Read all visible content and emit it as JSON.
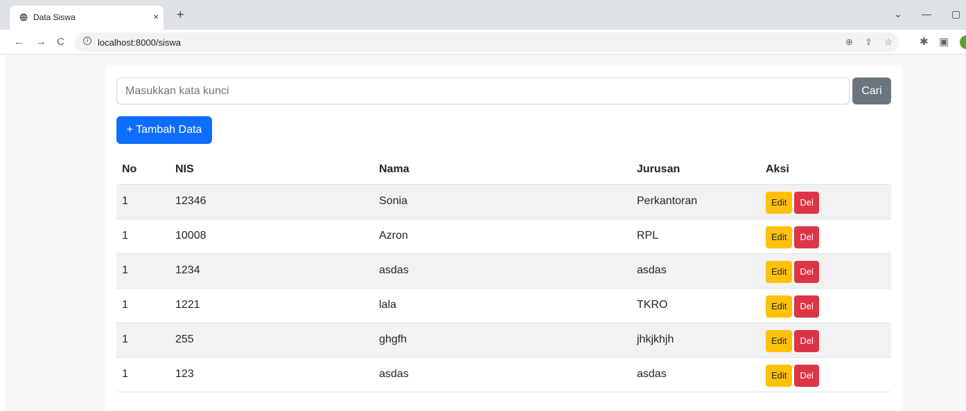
{
  "browser": {
    "tab_title": "Data Siswa",
    "tab_close": "×",
    "new_tab": "+",
    "url": "localhost:8000/siswa",
    "controls": {
      "chevron": "⌄",
      "minimize": "—",
      "maximize": "▢"
    },
    "nav": {
      "back": "←",
      "forward": "→",
      "reload": "C"
    },
    "icons": {
      "zoom": "⊕",
      "share": "⇪",
      "bookmark": "☆",
      "extensions": "✱",
      "sidepanel": "▣"
    }
  },
  "search": {
    "placeholder": "Masukkan kata kunci",
    "value": "",
    "button_label": "Cari"
  },
  "add_button": "+ Tambah Data",
  "table": {
    "headers": {
      "no": "No",
      "nis": "NIS",
      "nama": "Nama",
      "jurusan": "Jurusan",
      "aksi": "Aksi"
    },
    "rows": [
      {
        "no": "1",
        "nis": "12346",
        "nama": "Sonia",
        "jurusan": "Perkantoran",
        "edit": "Edit",
        "del": "Del"
      },
      {
        "no": "1",
        "nis": "10008",
        "nama": "Azron",
        "jurusan": "RPL",
        "edit": "Edit",
        "del": "Del"
      },
      {
        "no": "1",
        "nis": "1234",
        "nama": "asdas",
        "jurusan": "asdas",
        "edit": "Edit",
        "del": "Del"
      },
      {
        "no": "1",
        "nis": "1221",
        "nama": "lala",
        "jurusan": "TKRO",
        "edit": "Edit",
        "del": "Del"
      },
      {
        "no": "1",
        "nis": "255",
        "nama": "ghgfh",
        "jurusan": "jhkjkhjh",
        "edit": "Edit",
        "del": "Del"
      },
      {
        "no": "1",
        "nis": "123",
        "nama": "asdas",
        "jurusan": "asdas",
        "edit": "Edit",
        "del": "Del"
      }
    ]
  },
  "colors": {
    "primary": "#0d6efd",
    "secondary": "#6c757d",
    "warning": "#ffc107",
    "danger": "#dc3545"
  }
}
